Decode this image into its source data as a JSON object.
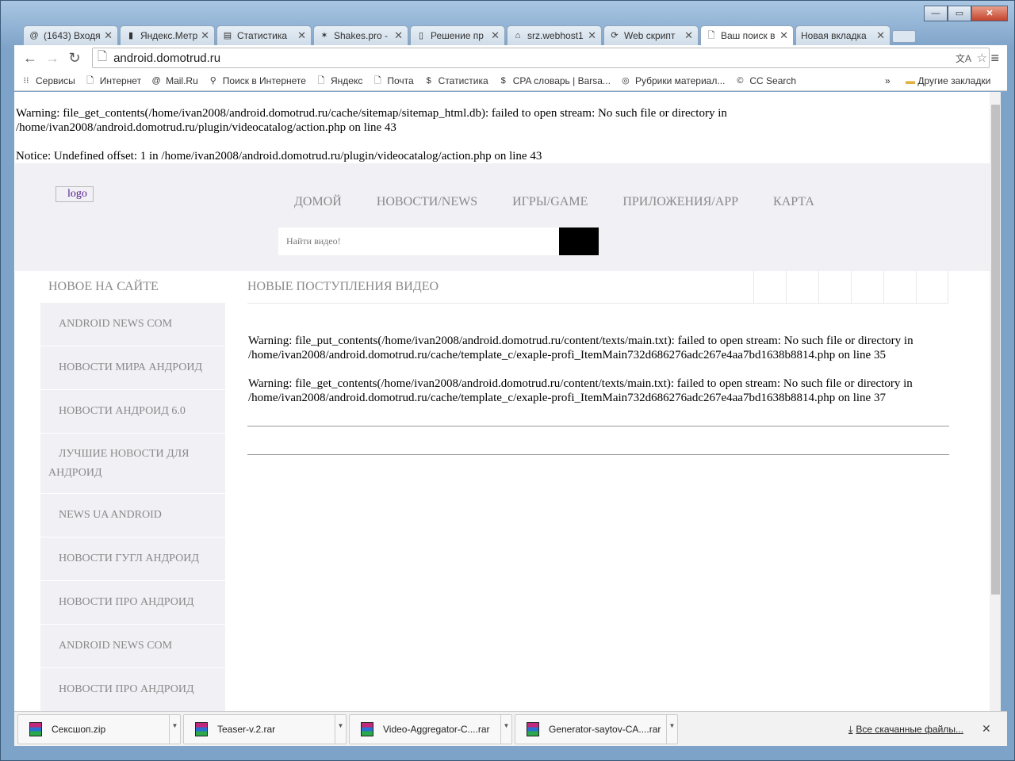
{
  "browser": {
    "tabs": [
      {
        "label": "(1643) Входя",
        "icon": "mail-at-icon"
      },
      {
        "label": "Яндекс.Метр",
        "icon": "metrika-icon"
      },
      {
        "label": "Статистика",
        "icon": "stats-icon"
      },
      {
        "label": "Shakes.pro -",
        "icon": "star-icon"
      },
      {
        "label": "Решение пр",
        "icon": "extinguisher-icon"
      },
      {
        "label": "srz.webhost1",
        "icon": "home-icon"
      },
      {
        "label": "Web скрипт",
        "icon": "sync-icon"
      },
      {
        "label": "Ваш поиск в",
        "icon": "page-icon",
        "active": true
      },
      {
        "label": "Новая вкладка",
        "icon": ""
      }
    ],
    "url": "android.domotrud.ru",
    "bookmarks": [
      {
        "label": "Сервисы",
        "icon": "apps-icon"
      },
      {
        "label": "Интернет",
        "icon": "page-icon"
      },
      {
        "label": "Mail.Ru",
        "icon": "mail-at-icon"
      },
      {
        "label": "Поиск в Интернете",
        "icon": "search-icon"
      },
      {
        "label": "Яндекс",
        "icon": "page-icon"
      },
      {
        "label": "Почта",
        "icon": "page-icon"
      },
      {
        "label": "Статистика",
        "icon": "dollar-icon"
      },
      {
        "label": "CPA словарь | Barsa...",
        "icon": "dollar-icon"
      },
      {
        "label": "Рубрики материал...",
        "icon": "globe-icon"
      },
      {
        "label": "CC Search",
        "icon": "cc-icon"
      }
    ],
    "more": "»",
    "other_bookmarks": "Другие закладки"
  },
  "page": {
    "warnings_top": [
      "Warning: file_get_contents(/home/ivan2008/android.domotrud.ru/cache/sitemap/sitemap_html.db): failed to open stream: No such file or directory in /home/ivan2008/android.domotrud.ru/plugin/videocatalog/action.php on line 43",
      "Notice: Undefined offset: 1 in /home/ivan2008/android.domotrud.ru/plugin/videocatalog/action.php on line 43"
    ],
    "logo_alt": "logo",
    "menu": [
      "ДОМОЙ",
      "НОВОСТИ/NEWS",
      "ИГРЫ/GAME",
      "ПРИЛОЖЕНИЯ/APP",
      "КАРТА"
    ],
    "search_placeholder": "Найти видео!",
    "sidebar": {
      "title": "НОВОЕ НА САЙТЕ",
      "items": [
        "ANDROID NEWS COM",
        "НОВОСТИ МИРА АНДРОИД",
        "НОВОСТИ АНДРОИД 6.0",
        "ЛУЧШИЕ НОВОСТИ ДЛЯ АНДРОИД",
        "NEWS UA ANDROID",
        "НОВОСТИ ГУГЛ АНДРОИД",
        "НОВОСТИ ПРО АНДРОИД",
        "ANDROID NEWS COM",
        "НОВОСТИ ПРО АНДРОИД"
      ]
    },
    "main": {
      "title": "НОВЫЕ ПОСТУПЛЕНИЯ ВИДЕО",
      "warnings": [
        "Warning: file_put_contents(/home/ivan2008/android.domotrud.ru/content/texts/main.txt): failed to open stream: No such file or directory in /home/ivan2008/android.domotrud.ru/cache/template_c/exaple-profi_ItemMain732d686276adc267e4aa7bd1638b8814.php on line 35",
        "Warning: file_get_contents(/home/ivan2008/android.domotrud.ru/content/texts/main.txt): failed to open stream: No such file or directory in /home/ivan2008/android.domotrud.ru/cache/template_c/exaple-profi_ItemMain732d686276adc267e4aa7bd1638b8814.php on line 37"
      ]
    }
  },
  "downloads": {
    "items": [
      "Сексшоп.zip",
      "Teaser-v.2.rar",
      "Video-Aggregator-C....rar",
      "Generator-saytov-CA....rar"
    ],
    "all": "Все скачанные файлы..."
  }
}
